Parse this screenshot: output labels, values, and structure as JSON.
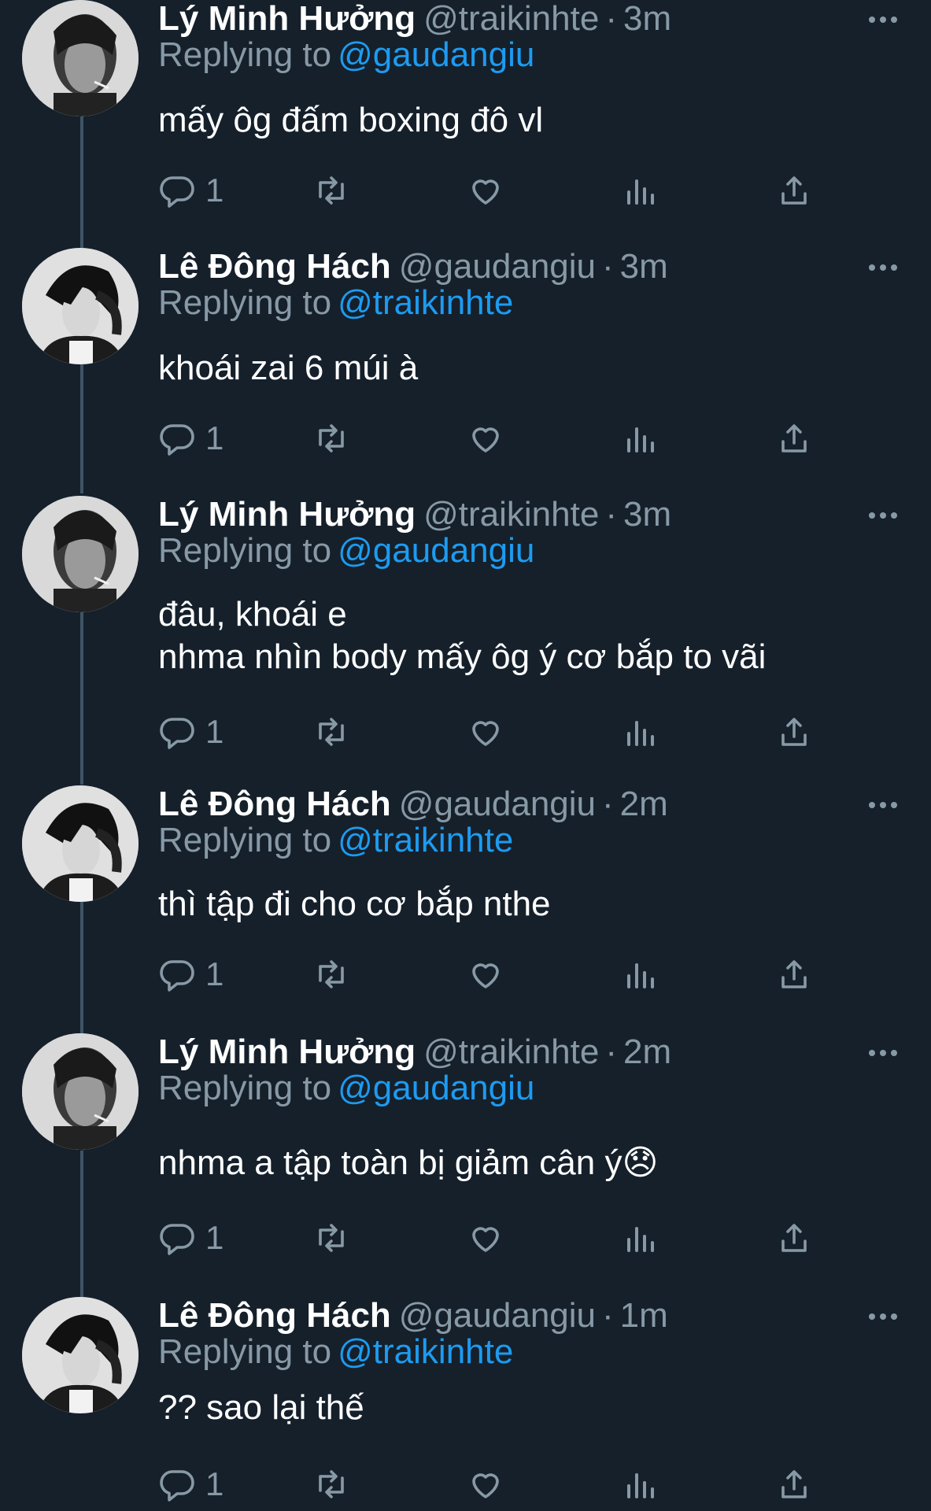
{
  "labels": {
    "replying_to": "Replying to",
    "separator": "·"
  },
  "tweets": [
    {
      "author": "Lý Minh Hưởng",
      "handle": "@traikinhte",
      "time": "3m",
      "reply_to": "@gaudangiu",
      "text": "mấy ôg đấm boxing đô vl",
      "reply_count": "1",
      "avatar": "avatar-minh-huong"
    },
    {
      "author": "Lê Đông Hách",
      "handle": "@gaudangiu",
      "time": "3m",
      "reply_to": "@traikinhte",
      "text": "khoái zai 6 múi à",
      "reply_count": "1",
      "avatar": "avatar-dong-hach"
    },
    {
      "author": "Lý Minh Hưởng",
      "handle": "@traikinhte",
      "time": "3m",
      "reply_to": "@gaudangiu",
      "text": "đâu, khoái e\nnhma nhìn body mấy ôg ý cơ bắp to vãi",
      "reply_count": "1",
      "avatar": "avatar-minh-huong"
    },
    {
      "author": "Lê Đông Hách",
      "handle": "@gaudangiu",
      "time": "2m",
      "reply_to": "@traikinhte",
      "text": "thì tập đi cho cơ bắp nthe",
      "reply_count": "1",
      "avatar": "avatar-dong-hach"
    },
    {
      "author": "Lý Minh Hưởng",
      "handle": "@traikinhte",
      "time": "2m",
      "reply_to": "@gaudangiu",
      "text": "nhma a tập toàn bị giảm cân ý😞",
      "reply_count": "1",
      "avatar": "avatar-minh-huong"
    },
    {
      "author": "Lê Đông Hách",
      "handle": "@gaudangiu",
      "time": "1m",
      "reply_to": "@traikinhte",
      "text": "?? sao lại thế",
      "reply_count": "1",
      "avatar": "avatar-dong-hach"
    }
  ],
  "icons": {
    "reply": "reply-icon",
    "retweet": "retweet-icon",
    "like": "heart-icon",
    "stats": "analytics-icon",
    "share": "share-icon",
    "more": "more-icon"
  },
  "colors": {
    "background": "#15202b",
    "accent": "#1d9bf0",
    "secondary_text": "#8899a6",
    "thread_line": "#3d5466"
  }
}
